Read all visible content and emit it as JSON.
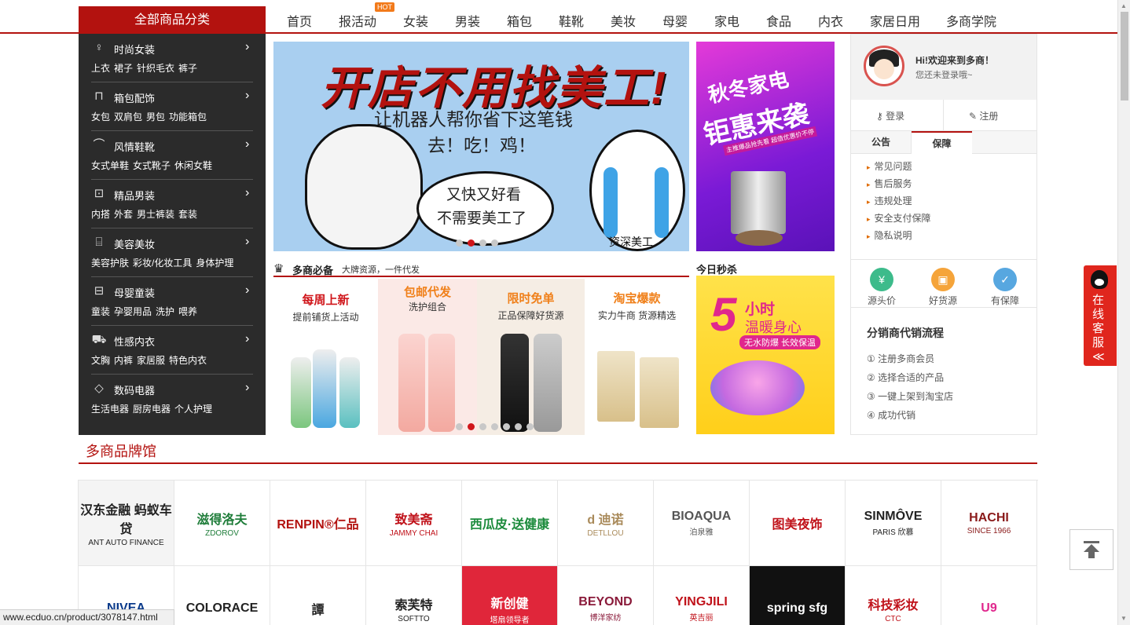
{
  "nav": {
    "all_categories": "全部商品分类",
    "hot_badge": "HOT",
    "items": [
      "首页",
      "报活动",
      "女装",
      "男装",
      "箱包",
      "鞋靴",
      "美妆",
      "母婴",
      "家电",
      "食品",
      "内衣",
      "家居日用",
      "多商学院"
    ]
  },
  "sidebar": [
    {
      "title": "时尚女装",
      "icon": "dress-icon",
      "subs": [
        "上衣",
        "裙子",
        "针织毛衣",
        "裤子"
      ]
    },
    {
      "title": "箱包配饰",
      "icon": "bag-icon",
      "subs": [
        "女包",
        "双肩包",
        "男包",
        "功能箱包"
      ]
    },
    {
      "title": "风情鞋靴",
      "icon": "shoe-icon",
      "subs": [
        "女式单鞋",
        "女式靴子",
        "休闲女鞋"
      ]
    },
    {
      "title": "精品男装",
      "icon": "shirt-icon",
      "subs": [
        "内搭",
        "外套",
        "男士裤装",
        "套装"
      ]
    },
    {
      "title": "美容美妆",
      "icon": "cosmetics-icon",
      "subs": [
        "美容护肤",
        "彩妆/化妆工具",
        "身体护理"
      ]
    },
    {
      "title": "母婴童装",
      "icon": "crib-icon",
      "subs": [
        "童装",
        "孕婴用品",
        "洗护",
        "喂养"
      ]
    },
    {
      "title": "性感内衣",
      "icon": "cart-icon",
      "subs": [
        "文胸",
        "内裤",
        "家居服",
        "特色内衣"
      ]
    },
    {
      "title": "数码电器",
      "icon": "diamond-icon",
      "subs": [
        "生活电器",
        "厨房电器",
        "个人护理"
      ]
    }
  ],
  "banner": {
    "headline": "开店不用找美工!",
    "line1": "让机器人帮你省下这笔钱",
    "line2": "去！吃！鸡！",
    "bubble1": "又快又好看",
    "bubble2": "不需要美工了",
    "caption": "资深美工"
  },
  "side_ad": {
    "line1": "秋冬家电",
    "line2": "钜惠来袭",
    "tag": "主推爆品抢先看  超值优惠价不停"
  },
  "must_have": {
    "title": "多商必备",
    "subtitle": "大牌资源，一件代发",
    "promos": [
      {
        "title": "每周上新",
        "sub": "提前铺货上活动",
        "color": "#d0161b"
      },
      {
        "title": "包邮代发",
        "sub": "洗护组合",
        "color": "#f0801a"
      },
      {
        "title": "限时免单",
        "sub": "正品保障好货源",
        "color": "#f0801a"
      },
      {
        "title": "淘宝爆款",
        "sub": "实力牛商 货源精选",
        "color": "#f0801a"
      }
    ]
  },
  "flash": {
    "title": "今日秒杀",
    "num": "5",
    "a": "小时",
    "b": "温暖身心",
    "c": "无水防爆 长效保温"
  },
  "user": {
    "hi": "Hi!欢迎来到多商！",
    "not_logged": "您还未登录哦~",
    "login": "登录",
    "register": "注册"
  },
  "tabs": {
    "notice": "公告",
    "guarantee": "保障"
  },
  "notices": [
    "常见问题",
    "售后服务",
    "违规处理",
    "安全支付保障",
    "隐私说明"
  ],
  "features": [
    {
      "label": "源头价",
      "color": "#3dbb8b",
      "icon": "yuan-icon",
      "glyph": "¥"
    },
    {
      "label": "好货源",
      "color": "#f5a43a",
      "icon": "box-icon",
      "glyph": "▣"
    },
    {
      "label": "有保障",
      "color": "#57a7e0",
      "icon": "shield-icon",
      "glyph": "✓"
    }
  ],
  "flow": {
    "title": "分销商代销流程",
    "steps": [
      "① 注册多商会员",
      "② 选择合适的产品",
      "③ 一键上架到淘宝店",
      "④ 成功代销"
    ]
  },
  "qq": {
    "label": "在线客服≪"
  },
  "brand": {
    "title": "多商品牌馆",
    "row1": [
      {
        "name": "汉东金融 蚂蚁车贷",
        "sub": "ANT AUTO FINANCE",
        "color": "#222"
      },
      {
        "name": "滋得洛夫",
        "sub": "ZDOROV",
        "color": "#1f7d3a"
      },
      {
        "name": "RENPIN®仁品",
        "sub": "",
        "color": "#b3120f"
      },
      {
        "name": "致美斋",
        "sub": "JAMMY CHAI",
        "color": "#c0121a"
      },
      {
        "name": "西瓜皮·送健康",
        "sub": "",
        "color": "#1a8a3a"
      },
      {
        "name": "d 迪诺",
        "sub": "DETLLOU",
        "color": "#a98a5a"
      },
      {
        "name": "BIOAQUA",
        "sub": "泊泉雅",
        "color": "#555"
      },
      {
        "name": "图美夜饰",
        "sub": "",
        "color": "#c0121a"
      },
      {
        "name": "SINMÔVE",
        "sub": "PARIS 欣慕",
        "color": "#222"
      },
      {
        "name": "HACHI",
        "sub": "SINCE 1966",
        "color": "#8a1a1a"
      }
    ],
    "row2": [
      {
        "name": "NIVEA",
        "sub": "",
        "color": "#0a3a8a"
      },
      {
        "name": "COLORACE",
        "sub": "",
        "color": "#222"
      },
      {
        "name": "譚",
        "sub": "",
        "color": "#222"
      },
      {
        "name": "索芙特",
        "sub": "SOFTTO",
        "color": "#222"
      },
      {
        "name": "新创健",
        "sub": "塔扇领导者",
        "color": "#fff",
        "bg": "#e0263a"
      },
      {
        "name": "BEYOND",
        "sub": "博洋家纺",
        "color": "#8a1a3a"
      },
      {
        "name": "YINGJILI",
        "sub": "英吉丽",
        "color": "#c0121a"
      },
      {
        "name": "spring sfg",
        "sub": "",
        "color": "#fff",
        "bg": "#111"
      },
      {
        "name": "科技彩妆",
        "sub": "CTC",
        "color": "#c0121a"
      },
      {
        "name": "U9",
        "sub": "",
        "color": "#e0278d"
      }
    ]
  },
  "status_url": "www.ecduo.cn/product/3078147.html"
}
